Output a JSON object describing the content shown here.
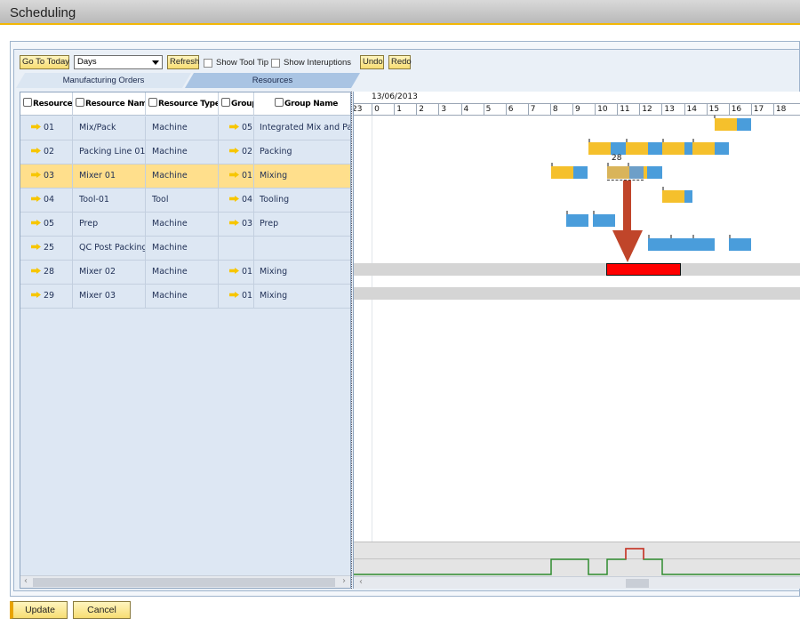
{
  "window": {
    "title": "Scheduling"
  },
  "toolbar": {
    "go_today": "Go To Today",
    "view_mode": "Days",
    "refresh": "Refresh",
    "show_tooltip": "Show Tool Tip",
    "show_interruptions": "Show Interuptions",
    "undo": "Undo",
    "redo": "Redo"
  },
  "tabs": [
    "Manufacturing Orders",
    "Resources"
  ],
  "grid": {
    "columns": [
      "Resource",
      "Resource Name",
      "Resource Type",
      "Group",
      "Group Name"
    ],
    "rows": [
      {
        "resource": "01",
        "name": "Mix/Pack",
        "type": "Machine",
        "group": "05",
        "group_name": "Integrated Mix and Pack",
        "selected": false
      },
      {
        "resource": "02",
        "name": "Packing Line 01",
        "type": "Machine",
        "group": "02",
        "group_name": "Packing",
        "selected": false
      },
      {
        "resource": "03",
        "name": "Mixer 01",
        "type": "Machine",
        "group": "01",
        "group_name": "Mixing",
        "selected": true
      },
      {
        "resource": "04",
        "name": "Tool-01",
        "type": "Tool",
        "group": "04",
        "group_name": "Tooling",
        "selected": false
      },
      {
        "resource": "05",
        "name": "Prep",
        "type": "Machine",
        "group": "03",
        "group_name": "Prep",
        "selected": false
      },
      {
        "resource": "25",
        "name": "QC Post Packing",
        "type": "Machine",
        "group": "",
        "group_name": "",
        "selected": false
      },
      {
        "resource": "28",
        "name": "Mixer 02",
        "type": "Machine",
        "group": "01",
        "group_name": "Mixing",
        "selected": false
      },
      {
        "resource": "29",
        "name": "Mixer 03",
        "type": "Machine",
        "group": "01",
        "group_name": "Mixing",
        "selected": false
      }
    ]
  },
  "chart": {
    "date": "13/06/2013",
    "hours": [
      "23",
      "0",
      "1",
      "2",
      "3",
      "4",
      "5",
      "6",
      "7",
      "8",
      "9",
      "10",
      "11",
      "12",
      "13",
      "14",
      "15",
      "16",
      "17",
      "18"
    ],
    "drag_label": "28",
    "colors": {
      "setup": "#f5c02c",
      "run": "#4a9ddb",
      "conflict": "#ff0000",
      "arrow": "#c0452a",
      "load": "#2e8b2e",
      "overload": "#e03030"
    }
  },
  "footer": {
    "update": "Update",
    "cancel": "Cancel"
  }
}
